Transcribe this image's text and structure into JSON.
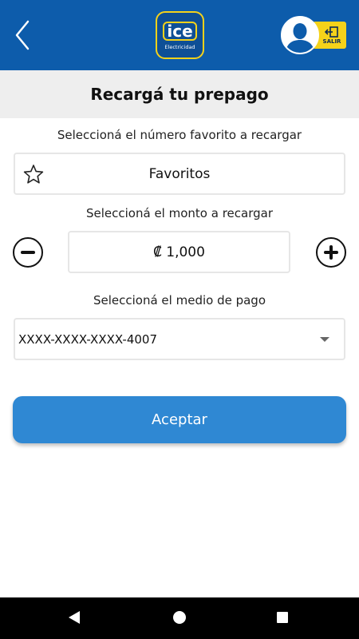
{
  "header": {
    "logo": {
      "word": "ice",
      "subtitle": "Electricidad"
    },
    "logout_label": "SALIR"
  },
  "page_title": "Recargá tu prepago",
  "favorites": {
    "label": "Seleccioná el número favorito a recargar",
    "value": "Favoritos"
  },
  "amount": {
    "label": "Seleccioná el monto a recargar",
    "value": "₡ 1,000"
  },
  "payment": {
    "label": "Seleccioná el medio de pago",
    "selected": "XXXX-XXXX-XXXX-4007"
  },
  "accept_label": "Aceptar",
  "colors": {
    "header_bg": "#0d5cab",
    "brand_yellow": "#f5d21a",
    "button_bg": "#2f88d3"
  },
  "icons": [
    "back-arrow-icon",
    "user-avatar-icon",
    "logout-icon",
    "star-icon",
    "minus-icon",
    "plus-icon",
    "dropdown-caret-icon"
  ]
}
